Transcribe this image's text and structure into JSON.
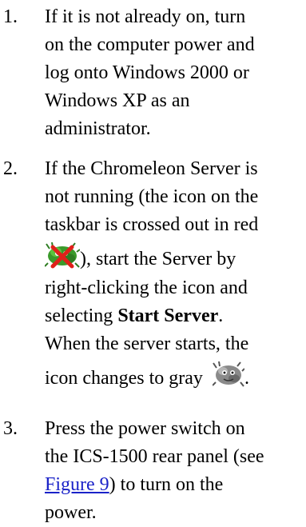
{
  "steps": [
    {
      "number": "1.",
      "lines": [
        "If it is not already on, turn",
        "on the computer power and",
        "log onto Windows 2000 or",
        "Windows XP as an",
        "administrator."
      ]
    },
    {
      "number": "2.",
      "line1": "If the Chromeleon Server is",
      "line2": "not running (the icon on the",
      "line3": "taskbar is crossed out in red",
      "line4_after_icon": "), start the Server by",
      "line5": "right-clicking the icon and",
      "line6_pre": "selecting ",
      "line6_bold": "Start Server",
      "line6_post": ".",
      "line7": "When the server starts, the",
      "line8_pre": "icon changes to gray",
      "line8_post": ".",
      "icon_stopped": "server-stopped-icon",
      "icon_running": "server-gray-icon"
    },
    {
      "number": "3.",
      "line1": "Press the power switch on",
      "line2_pre": "the ICS-1500 rear panel (see",
      "line3_link": "Figure 9",
      "line3_post": ") to turn on the",
      "line4": "power."
    }
  ],
  "colors": {
    "text": "#000000",
    "link": "#1a22c8",
    "cross_red": "#e0201a",
    "icon_green": "#3a9a2a",
    "icon_gray": "#8a8a8a"
  }
}
